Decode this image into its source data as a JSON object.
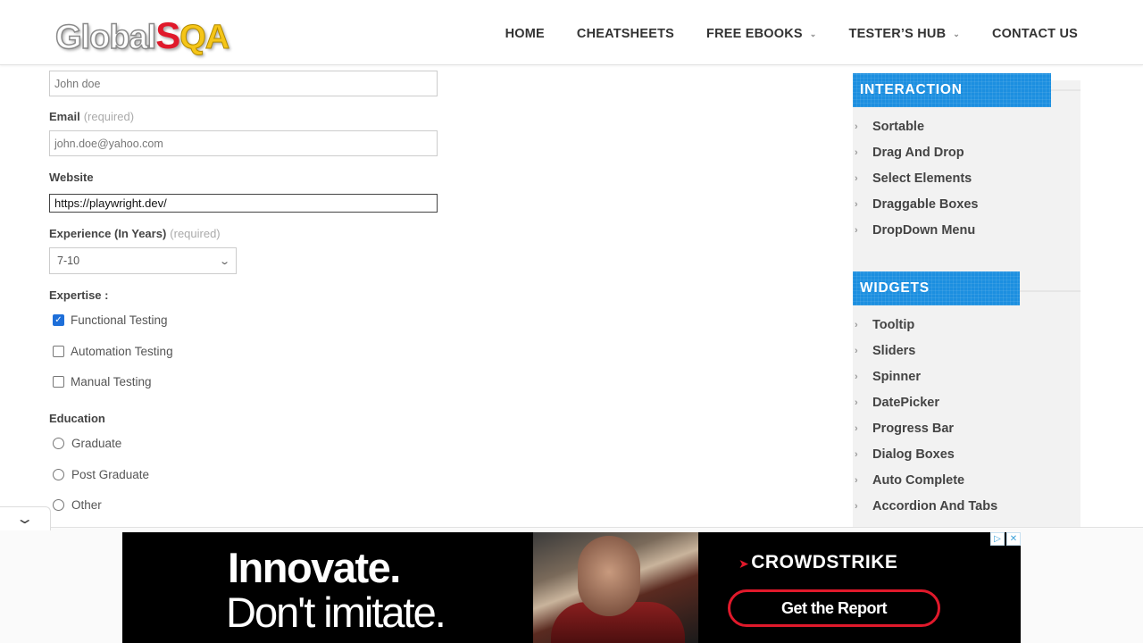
{
  "header": {
    "logo": {
      "part1": "Global",
      "part2": "S",
      "part3": "QA"
    },
    "nav": [
      {
        "label": "HOME",
        "has_caret": false
      },
      {
        "label": "CHEATSHEETS",
        "has_caret": false
      },
      {
        "label": "FREE EBOOKS",
        "has_caret": true
      },
      {
        "label": "TESTER’S HUB",
        "has_caret": true
      },
      {
        "label": "CONTACT US",
        "has_caret": false
      }
    ]
  },
  "form": {
    "name_input": {
      "value": "John doe"
    },
    "email": {
      "label": "Email",
      "required": "(required)",
      "value": "john.doe@yahoo.com"
    },
    "website": {
      "label": "Website",
      "value": "https://playwright.dev/"
    },
    "experience": {
      "label": "Experience (In Years)",
      "required": "(required)",
      "selected": "7-10"
    },
    "expertise": {
      "label": "Expertise :",
      "options": [
        {
          "label": "Functional Testing",
          "checked": true
        },
        {
          "label": "Automation Testing",
          "checked": false
        },
        {
          "label": "Manual Testing",
          "checked": false
        }
      ]
    },
    "education": {
      "label": "Education",
      "options": [
        {
          "label": "Graduate"
        },
        {
          "label": "Post Graduate"
        },
        {
          "label": "Other"
        }
      ]
    }
  },
  "sidebar": {
    "interaction": {
      "title": "INTERACTION",
      "items": [
        "Sortable",
        "Drag And Drop",
        "Select Elements",
        "Draggable Boxes",
        "DropDown Menu"
      ]
    },
    "widgets": {
      "title": "WIDGETS",
      "items": [
        "Tooltip",
        "Sliders",
        "Spinner",
        "DatePicker",
        "Progress Bar",
        "Dialog Boxes",
        "Auto Complete",
        "Accordion And Tabs"
      ]
    }
  },
  "ad": {
    "headline1": "Innovate.",
    "headline2": "Don't imitate.",
    "brand": "CROWDSTRIKE",
    "cta": "Get the Report"
  },
  "colors": {
    "accent": "#1c8fe0",
    "brand_red": "#e0192b",
    "checkbox": "#1e6fd9"
  }
}
